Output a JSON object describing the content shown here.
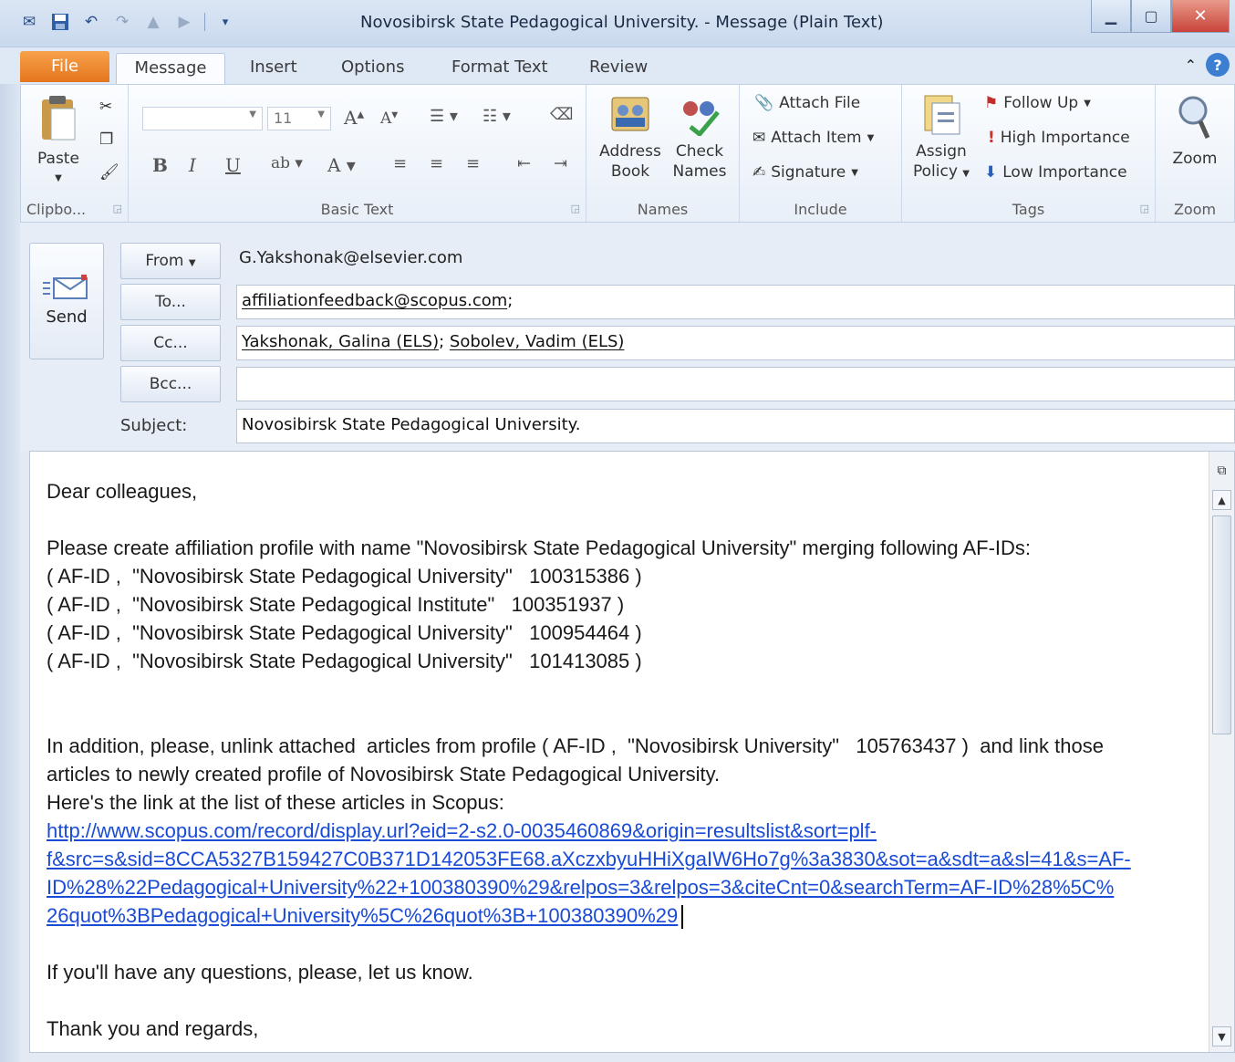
{
  "window": {
    "title": "Novosibirsk State Pedagogical University. - Message (Plain Text)"
  },
  "tabs": [
    "File",
    "Message",
    "Insert",
    "Options",
    "Format Text",
    "Review"
  ],
  "ribbon": {
    "clipboard": {
      "paste": "Paste",
      "group": "Clipbo..."
    },
    "basic_text": {
      "font_size": "11",
      "bold": "B",
      "italic": "I",
      "underline": "U",
      "group": "Basic Text"
    },
    "names": {
      "address_book_1": "Address",
      "address_book_2": "Book",
      "check_names_1": "Check",
      "check_names_2": "Names",
      "group": "Names"
    },
    "include": {
      "attach_file": "Attach File",
      "attach_item": "Attach Item",
      "signature": "Signature",
      "group": "Include"
    },
    "tags": {
      "assign_policy_1": "Assign",
      "assign_policy_2": "Policy",
      "follow_up": "Follow Up",
      "high_importance": "High Importance",
      "low_importance": "Low Importance",
      "group": "Tags"
    },
    "zoom": {
      "zoom": "Zoom",
      "group": "Zoom"
    }
  },
  "header": {
    "send": "Send",
    "from_label": "From",
    "from_value": "G.Yakshonak@elsevier.com",
    "to_label": "To...",
    "to_value": "affiliationfeedback@scopus.com",
    "to_suffix": ";",
    "cc_label": "Cc...",
    "cc_value_1": "Yakshonak, Galina (ELS)",
    "cc_sep": "; ",
    "cc_value_2": "Sobolev, Vadim (ELS)",
    "bcc_label": "Bcc...",
    "bcc_value": "",
    "subject_label": "Subject:",
    "subject_value": "Novosibirsk State Pedagogical University."
  },
  "body": {
    "greeting": "Dear colleagues,",
    "p1": "Please create affiliation profile with name \"Novosibirsk State Pedagogical University\" merging following AF-IDs:",
    "ids": [
      "( AF-ID ,  \"Novosibirsk State Pedagogical University\"   100315386 )",
      "( AF-ID ,  \"Novosibirsk State Pedagogical Institute\"   100351937 )",
      "( AF-ID ,  \"Novosibirsk State Pedagogical University\"   100954464 )",
      "( AF-ID ,  \"Novosibirsk State Pedagogical University\"   101413085 )"
    ],
    "p2_line1": "In addition, please, unlink attached  articles from profile ( AF-ID ,  \"Novosibirsk University\"   105763437 )  and link those",
    "p2_line2": "articles to newly created profile of Novosibirsk State Pedagogical University.",
    "p2_line3": "Here's the link at the list of these articles in Scopus:",
    "link_lines": [
      "http://www.scopus.com/record/display.url?eid=2-s2.0-0035460869&origin=resultslist&sort=plf-",
      "f&src=s&sid=8CCA5327B159427C0B371D142053FE68.aXczxbyuHHiXgaIW6Ho7g%3a3830&sot=a&sdt=a&sl=41&s=AF-",
      "ID%28%22Pedagogical+University%22+100380390%29&relpos=3&relpos=3&citeCnt=0&searchTerm=AF-ID%28%5C%",
      "26quot%3BPedagogical+University%5C%26quot%3B+100380390%29"
    ],
    "questions": "If you'll have any questions, please, let us know.",
    "closing": "Thank you and regards,"
  }
}
